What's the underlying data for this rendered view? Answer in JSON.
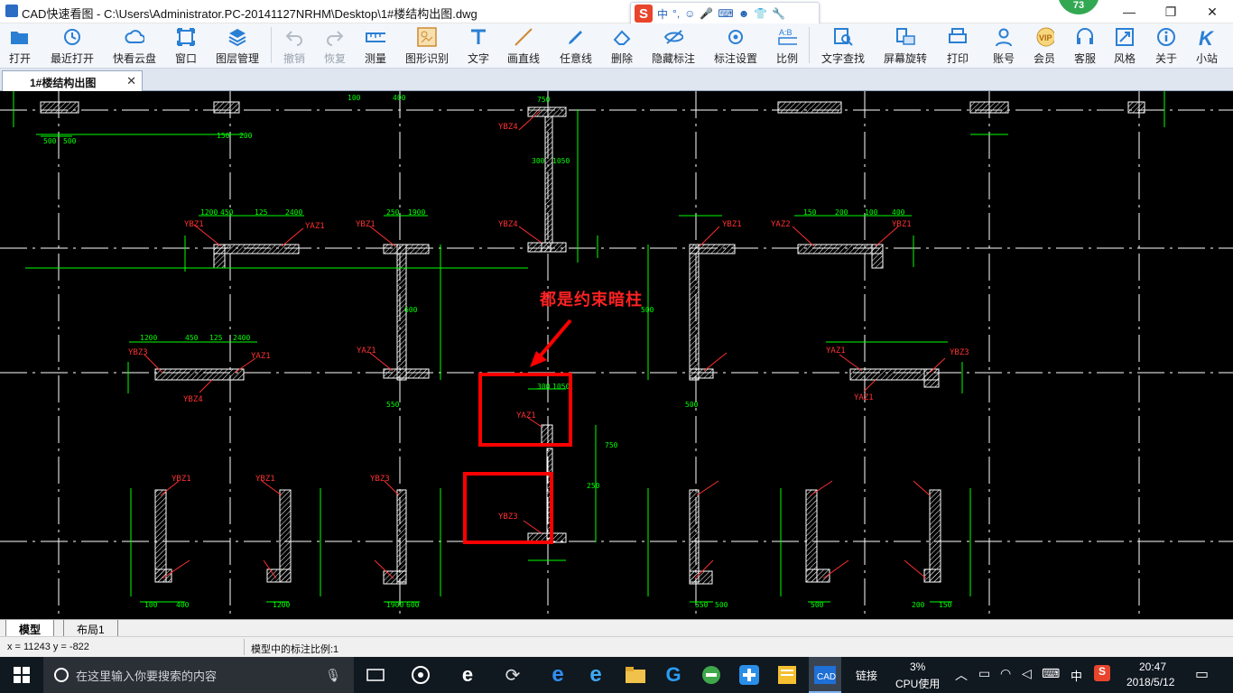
{
  "window": {
    "title": "CAD快速看图 - C:\\Users\\Administrator.PC-20141127NRHM\\Desktop\\1#楼结构出图.dwg",
    "minimize": "—",
    "maximize": "❐",
    "close": "✕",
    "badge": "73"
  },
  "ime": {
    "mode": "中",
    "punct": "°,"
  },
  "toolbar": {
    "items": [
      {
        "label": "打开",
        "icon": "folder-open-icon",
        "disabled": false
      },
      {
        "label": "最近打开",
        "icon": "history-icon",
        "disabled": false
      },
      {
        "label": "快看云盘",
        "icon": "cloud-icon",
        "disabled": false
      },
      {
        "label": "窗口",
        "icon": "window-icon",
        "disabled": false
      },
      {
        "label": "图层管理",
        "icon": "layers-icon",
        "disabled": false
      },
      {
        "label": "撤销",
        "icon": "undo-icon",
        "disabled": true
      },
      {
        "label": "恢复",
        "icon": "redo-icon",
        "disabled": true
      },
      {
        "label": "测量",
        "icon": "ruler-icon",
        "disabled": false
      },
      {
        "label": "图形识别",
        "icon": "shape-recognize-icon",
        "disabled": false
      },
      {
        "label": "文字",
        "icon": "text-icon",
        "disabled": false
      },
      {
        "label": "画直线",
        "icon": "line-icon",
        "disabled": false
      },
      {
        "label": "任意线",
        "icon": "pencil-icon",
        "disabled": false
      },
      {
        "label": "删除",
        "icon": "eraser-icon",
        "disabled": false
      },
      {
        "label": "隐藏标注",
        "icon": "eye-hide-icon",
        "disabled": false
      },
      {
        "label": "标注设置",
        "icon": "annotation-settings-icon",
        "disabled": false
      },
      {
        "label": "比例",
        "icon": "scale-icon",
        "disabled": false
      },
      {
        "label": "文字查找",
        "icon": "text-search-icon",
        "disabled": false
      },
      {
        "label": "屏幕旋转",
        "icon": "rotate-screen-icon",
        "disabled": false
      },
      {
        "label": "打印",
        "icon": "printer-icon",
        "disabled": false
      },
      {
        "label": "账号",
        "icon": "user-icon",
        "disabled": false
      },
      {
        "label": "会员",
        "icon": "vip-icon",
        "disabled": false
      },
      {
        "label": "客服",
        "icon": "headset-icon",
        "disabled": false
      },
      {
        "label": "风格",
        "icon": "style-icon",
        "disabled": false
      },
      {
        "label": "关于",
        "icon": "info-icon",
        "disabled": false
      },
      {
        "label": "小站",
        "icon": "k-site-icon",
        "disabled": false
      }
    ]
  },
  "tabs": {
    "document": "1#楼结构出图",
    "close": "✕"
  },
  "canvas": {
    "annotation": "都是约束暗柱",
    "labels": [
      "YBZ4",
      "YBZ4",
      "YBZ1",
      "YBZ1",
      "YAZ1",
      "YAZ1",
      "YBZ3",
      "YAZ2",
      "YBZ1",
      "YBZ1",
      "YBZ3",
      "YAZ1",
      "YAZ1",
      "YBZ4",
      "YAZ1",
      "YAZ1",
      "YBZ3",
      "YBZ1",
      "YBZ1",
      "YBZ3"
    ],
    "dims": [
      "500",
      "500",
      "150",
      "200",
      "100",
      "400",
      "1200",
      "450",
      "125",
      "2400",
      "300",
      "1050",
      "750",
      "250",
      "1900",
      "600",
      "550"
    ],
    "colors": {
      "background": "#000000",
      "axis": "#ffffff",
      "dim": "#00ff00",
      "label": "#ff3030",
      "wall": "#ffffff",
      "highlight": "#ff0000"
    }
  },
  "model_tabs": {
    "model": "模型",
    "layout": "布局1"
  },
  "status": {
    "coords": "x = 11243  y = -822",
    "scale": "模型中的标注比例:1"
  },
  "taskbar": {
    "search_placeholder": "在这里输入你要搜索的内容",
    "link": "链接",
    "cpu": "3%",
    "cpu_label": "CPU使用",
    "ime": "中",
    "time": "20:47",
    "date": "2018/5/12"
  }
}
